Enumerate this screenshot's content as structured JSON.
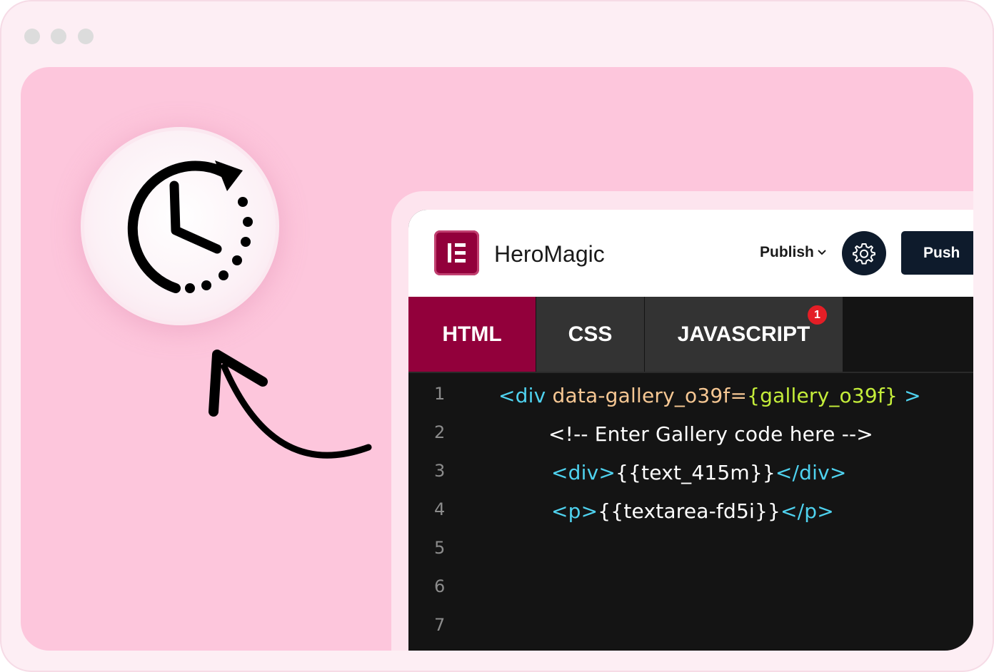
{
  "app": {
    "name": "HeroMagic",
    "logo_icon": "elementor-logo-icon"
  },
  "toolbar": {
    "publish_label": "Publish",
    "push_label": "Push",
    "settings_icon": "gear-icon"
  },
  "tabs": [
    {
      "label": "HTML",
      "active": true
    },
    {
      "label": "CSS",
      "active": false
    },
    {
      "label": "JAVASCRIPT",
      "active": false,
      "badge": "1"
    }
  ],
  "code": {
    "line_numbers": [
      "1",
      "2",
      "3",
      "4",
      "5",
      "6",
      "7"
    ],
    "lines": [
      {
        "indent": 0,
        "tokens": [
          {
            "type": "tag",
            "text": "<div "
          },
          {
            "type": "attr",
            "text": "data-gallery_o39f="
          },
          {
            "type": "brace",
            "text": "{gallery_o39f}"
          },
          {
            "type": "tag",
            "text": " >"
          }
        ]
      },
      {
        "indent": 1,
        "tokens": [
          {
            "type": "txt",
            "text": "<!-- Enter Gallery code here -->"
          }
        ]
      },
      {
        "indent": 1,
        "tokens": [
          {
            "type": "tag",
            "text": "<div>"
          },
          {
            "type": "txt",
            "text": "{{text_415m}}"
          },
          {
            "type": "tag",
            "text": "</div>"
          }
        ]
      },
      {
        "indent": 1,
        "tokens": [
          {
            "type": "tag",
            "text": "<p>"
          },
          {
            "type": "txt",
            "text": "{{textarea-fd5i}}"
          },
          {
            "type": "tag",
            "text": "</p>"
          }
        ]
      }
    ]
  },
  "colors": {
    "accent": "#92003b",
    "panel_bg": "#fdc6dc",
    "editor_bg": "#141414",
    "tag": "#4fd2ef",
    "attr": "#f6c793",
    "brace": "#c4ed3a"
  },
  "decor": {
    "clock_icon": "clock-history-icon",
    "arrow_icon": "curved-arrow-icon"
  }
}
